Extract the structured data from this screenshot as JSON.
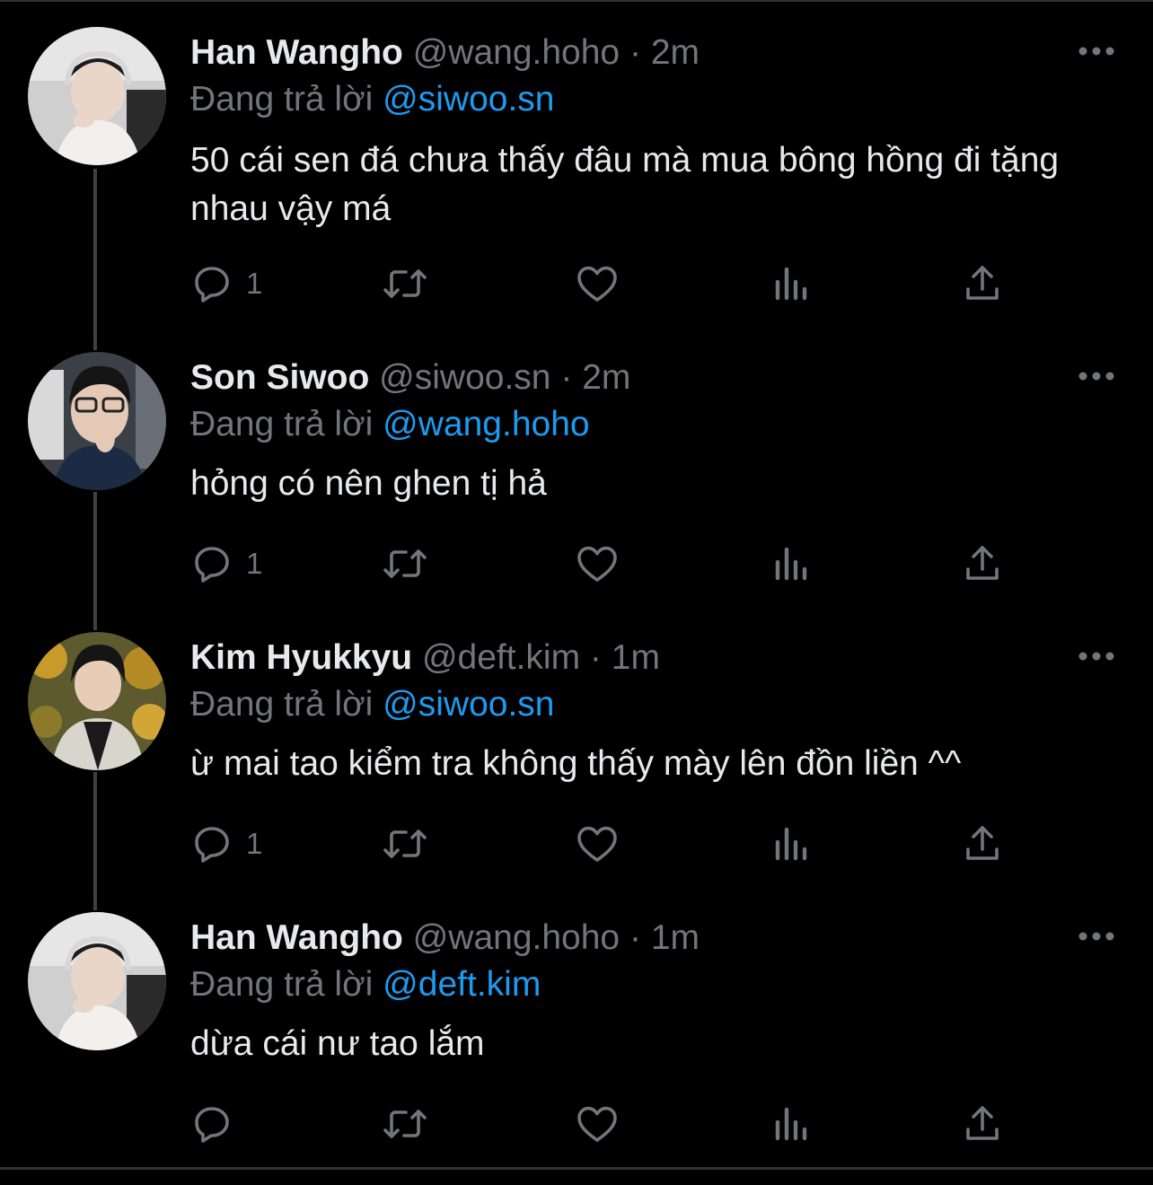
{
  "tweets": [
    {
      "name": "Han Wangho",
      "handle": "@wang.hoho",
      "time": "2m",
      "replying_label": "Đang trả lời",
      "replying_to": "@siwoo.sn",
      "text": "50 cái sen đá chưa thấy đâu mà mua bông hồng đi tặng nhau vậy má",
      "reply_count": "1"
    },
    {
      "name": "Son Siwoo",
      "handle": "@siwoo.sn",
      "time": "2m",
      "replying_label": "Đang trả lời",
      "replying_to": "@wang.hoho",
      "text": "hỏng có nên ghen tị hả",
      "reply_count": "1"
    },
    {
      "name": "Kim Hyukkyu",
      "handle": "@deft.kim",
      "time": "1m",
      "replying_label": "Đang trả lời",
      "replying_to": "@siwoo.sn",
      "text": "ừ mai tao kiểm tra không thấy mày lên đồn liền ^^",
      "reply_count": "1"
    },
    {
      "name": "Han Wangho",
      "handle": "@wang.hoho",
      "time": "1m",
      "replying_label": "Đang trả lời",
      "replying_to": "@deft.kim",
      "text": "dừa cái nư tao lắm",
      "reply_count": ""
    }
  ],
  "separator": "·",
  "icons": {
    "reply": "reply-icon",
    "retweet": "retweet-icon",
    "like": "like-icon",
    "views": "views-icon",
    "share": "share-icon",
    "more": "more-icon"
  },
  "colors": {
    "background": "#000000",
    "text": "#e7e9ea",
    "secondary": "#71767b",
    "link": "#1d9bf0"
  }
}
